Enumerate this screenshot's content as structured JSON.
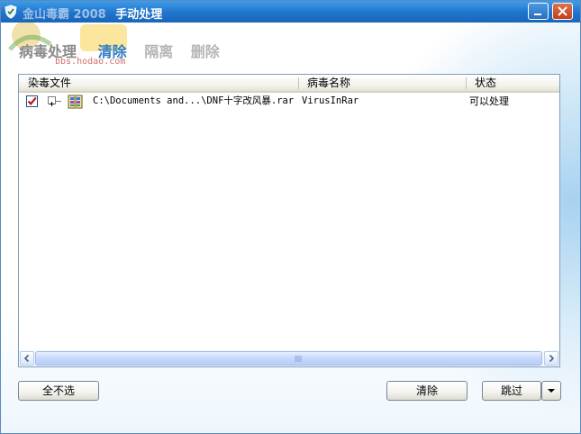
{
  "window": {
    "product_title": "金山毒霸 2008",
    "title": "手动处理",
    "minimize_label": "—",
    "close_label": "✕"
  },
  "watermark_text": "bbs.hodao.com",
  "steps": {
    "title": "病毒处理",
    "items": [
      {
        "label": "清除",
        "state": "active"
      },
      {
        "label": "隔离",
        "state": "idle"
      },
      {
        "label": "删除",
        "state": "idle"
      }
    ]
  },
  "list": {
    "columns": [
      "染毒文件",
      "病毒名称",
      "状态"
    ],
    "rows": [
      {
        "checked": true,
        "expand": "+",
        "icon": "archive-file-icon",
        "file": "C:\\Documents and...\\DNF十字改风暴.rar",
        "virus": "VirusInRar",
        "status": "可以处理"
      }
    ]
  },
  "buttons": {
    "unselect_all": "全不选",
    "clean": "清除",
    "skip": "跳过"
  },
  "colors": {
    "title_bar": "#1f74cc",
    "active_step": "#2e7dcc",
    "idle_step": "#b5b5b5",
    "check": "#c0141a"
  }
}
